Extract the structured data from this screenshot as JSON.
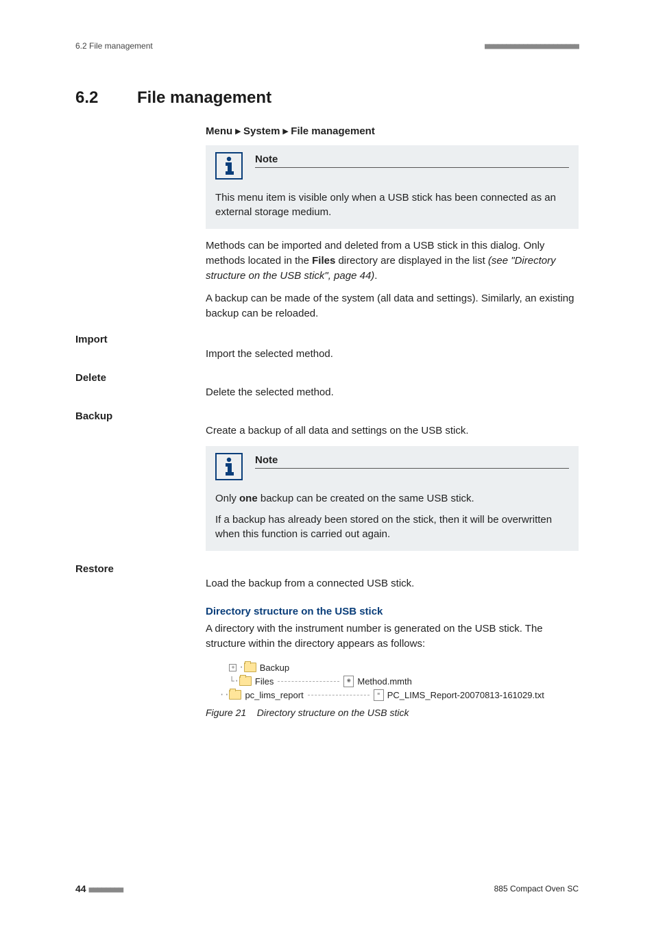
{
  "header": {
    "left": "6.2 File management",
    "right": "■■■■■■■■■■■■■■■■■■■■■■"
  },
  "section": {
    "number": "6.2",
    "title": "File management"
  },
  "breadcrumb": {
    "a": "Menu",
    "b": "System",
    "c": "File management"
  },
  "note1": {
    "title": "Note",
    "body": "This menu item is visible only when a USB stick has been connected as an external storage medium."
  },
  "para1a": "Methods can be imported and deleted from a USB stick in this dialog. Only methods located in the ",
  "para1_files": "Files",
  "para1b": " directory are displayed in the list ",
  "para1c": "(see \"Directory structure on the USB stick\", page 44)",
  "para1d": ".",
  "para2": "A backup can be made of the system (all data and settings). Similarly, an existing backup can be reloaded.",
  "cmds": {
    "import_label": "Import",
    "import_desc": "Import the selected method.",
    "delete_label": "Delete",
    "delete_desc": "Delete the selected method.",
    "backup_label": "Backup",
    "backup_desc": "Create a backup of all data and settings on the USB stick.",
    "restore_label": "Restore",
    "restore_desc": "Load the backup from a connected USB stick."
  },
  "note2": {
    "title": "Note",
    "line1a": "Only ",
    "line1_one": "one",
    "line1b": " backup can be created on the same USB stick.",
    "line2": "If a backup has already been stored on the stick, then it will be overwritten when this function is carried out again."
  },
  "subheading": "Directory structure on the USB stick",
  "para3": "A directory with the instrument number is generated on the USB stick. The structure within the directory appears as follows:",
  "tree": {
    "backup": "Backup",
    "files": "Files",
    "method": "Method.mmth",
    "pclims": "pc_lims_report",
    "pclims_file": "PC_LIMS_Report-20070813-161029.txt"
  },
  "figure": {
    "num": "Figure 21",
    "caption": "Directory structure on the USB stick"
  },
  "footer": {
    "page": "44",
    "dots": "■■■■■■■■",
    "product": "885 Compact Oven SC"
  }
}
